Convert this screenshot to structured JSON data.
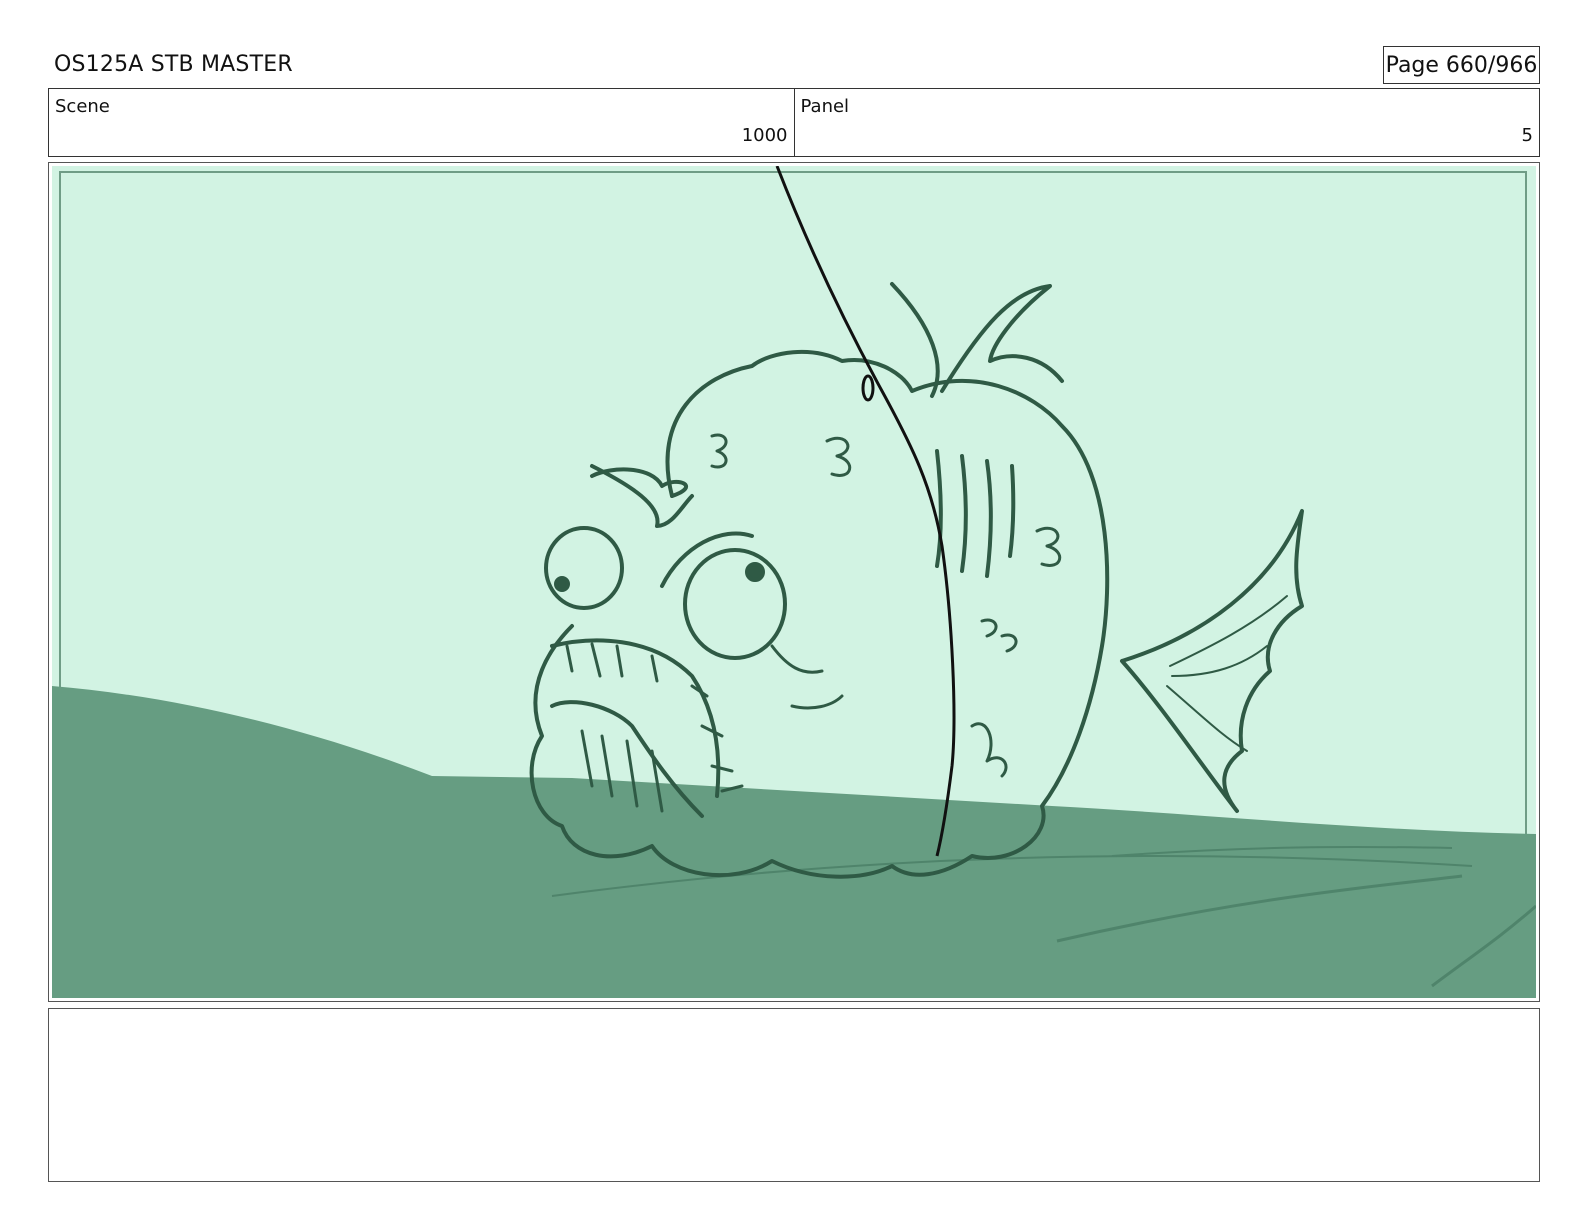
{
  "header": {
    "title": "OS125A STB MASTER",
    "page": "Page 660/966"
  },
  "info": {
    "scene_label": "Scene",
    "scene_value": "1000",
    "panel_label": "Panel",
    "panel_value": "5"
  },
  "artwork": {
    "sky_color": "#d2f3e3",
    "ground_color": "#669d82",
    "line_color": "#2f5a45"
  }
}
